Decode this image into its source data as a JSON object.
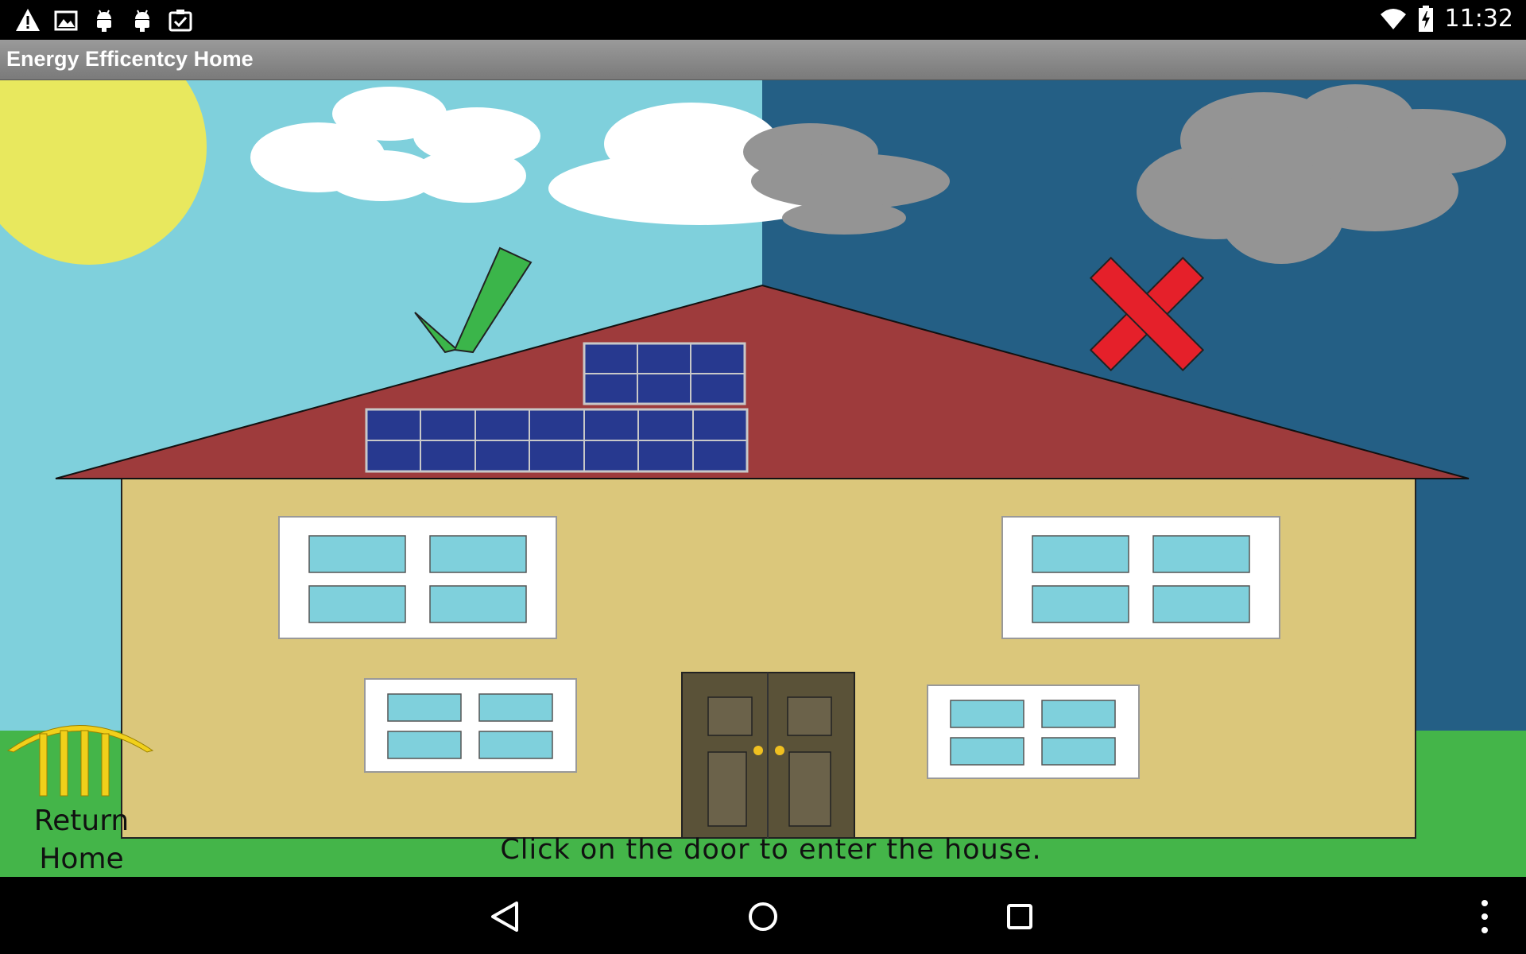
{
  "status_bar": {
    "time": "11:32",
    "left_icons": [
      "warning-icon",
      "image-icon",
      "android-icon",
      "android-icon",
      "clipboard-check-icon"
    ],
    "right_icons": [
      "wifi-icon",
      "battery-charging-icon"
    ]
  },
  "app": {
    "title": "Energy Efficentcy Home"
  },
  "scene": {
    "instruction": "Click on the door to enter the house.",
    "return_home_line1": "Return",
    "return_home_line2": "Home",
    "good_marker": "checkmark-icon",
    "bad_marker": "x-mark-icon",
    "colors": {
      "sky_day": "#7fd0dc",
      "sky_night": "#245f85",
      "sun": "#e8e85e",
      "roof": "#9e3b3c",
      "wall": "#dbc77b",
      "grass": "#44b549",
      "door": "#5a5238",
      "solar_panel": "#27398f",
      "check": "#3bb54a",
      "cross": "#e5202a"
    }
  },
  "nav_bar": {
    "buttons": [
      "back-icon",
      "home-icon",
      "recents-icon",
      "overflow-menu-icon"
    ]
  }
}
